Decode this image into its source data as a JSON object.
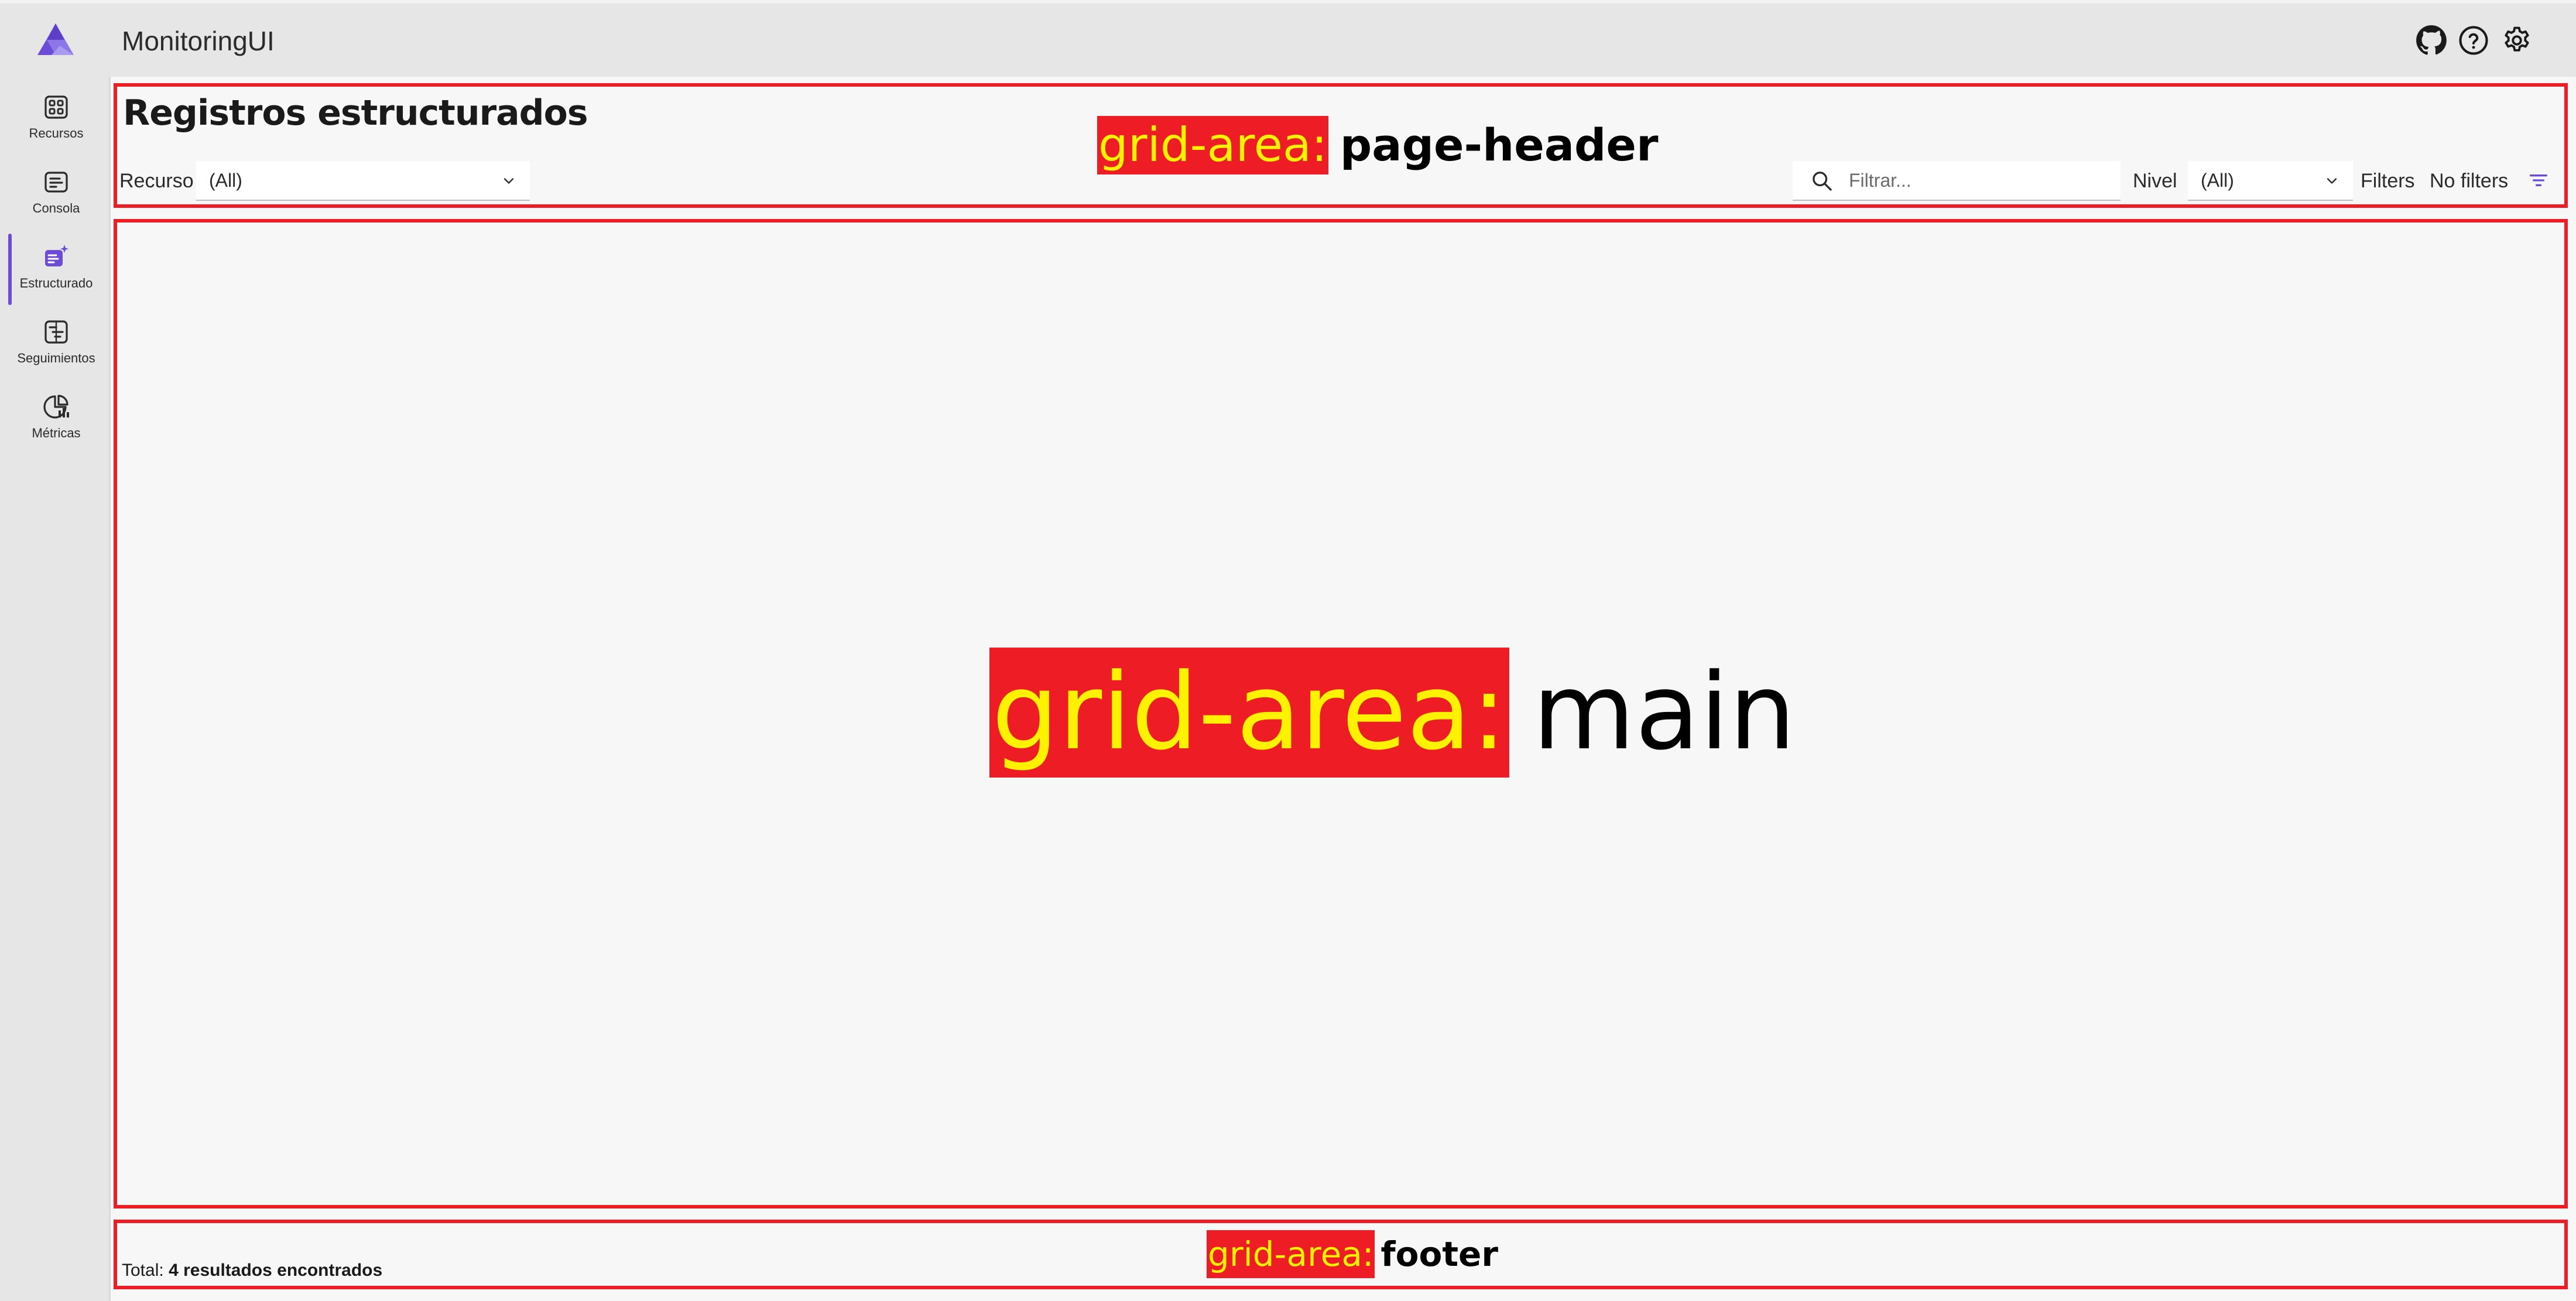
{
  "app": {
    "title": "MonitoringUI"
  },
  "header": {
    "icons": [
      "github-icon",
      "help-icon",
      "settings-icon"
    ]
  },
  "sidebar": {
    "items": [
      {
        "label": "Recursos",
        "icon": "resources-icon",
        "active": false
      },
      {
        "label": "Consola",
        "icon": "console-icon",
        "active": false
      },
      {
        "label": "Estructurado",
        "icon": "structured-icon",
        "active": true
      },
      {
        "label": "Seguimientos",
        "icon": "traces-icon",
        "active": false
      },
      {
        "label": "Métricas",
        "icon": "metrics-icon",
        "active": false
      }
    ]
  },
  "page": {
    "title": "Registros estructurados",
    "resource_label": "Recurso",
    "resource_value": "(All)",
    "search_placeholder": "Filtrar...",
    "level_label": "Nivel",
    "level_value": "(All)",
    "filters_label": "Filters",
    "no_filters_label": "No filters"
  },
  "grid_areas": {
    "key": "grid-area:",
    "page_header": "page-header",
    "main": "main",
    "footer": "footer"
  },
  "footer": {
    "total_prefix": "Total:",
    "total_value": "4 resultados encontrados"
  },
  "colors": {
    "accent": "#6b4bd8",
    "outline": "#ee1c24",
    "label_highlight": "#fff200"
  }
}
